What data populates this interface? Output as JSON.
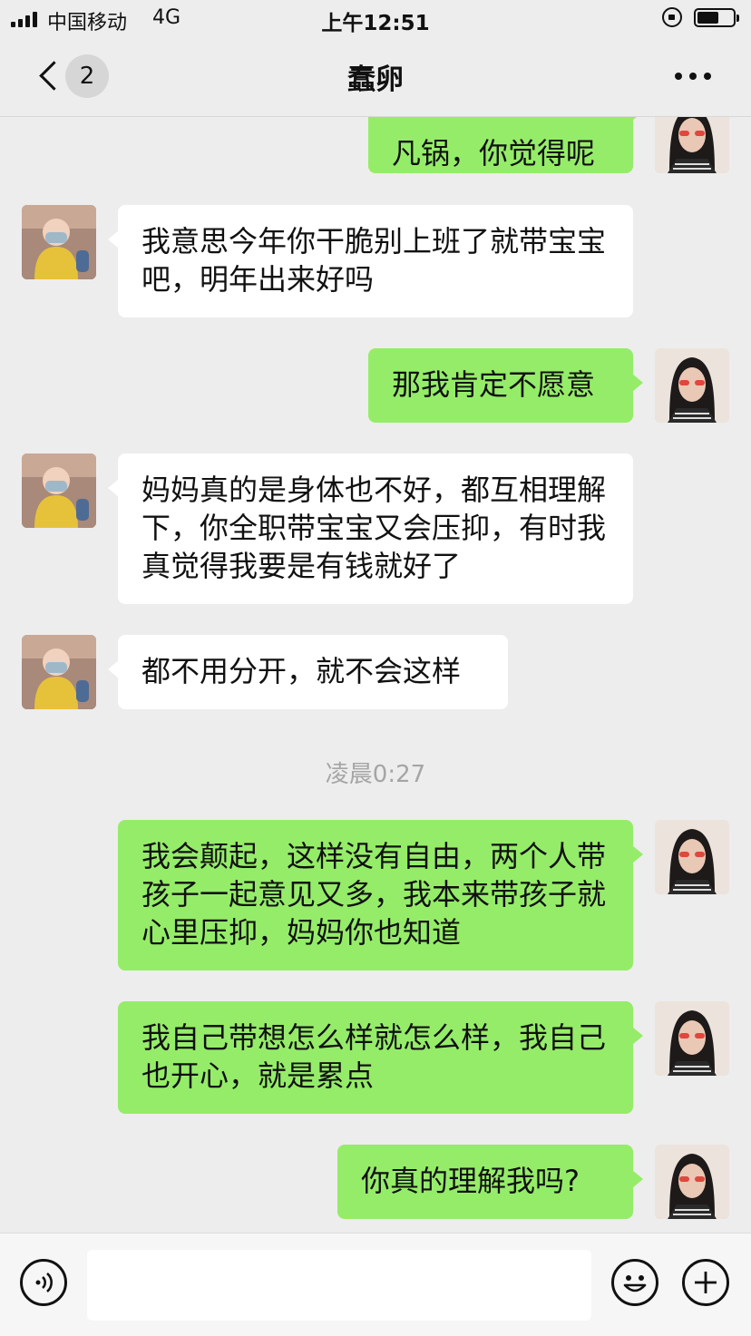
{
  "status_bar": {
    "carrier": "中国移动",
    "network": "4G",
    "time": "上午12:51",
    "battery_level": 0.6
  },
  "nav": {
    "unread_count": "2",
    "title": "蠢卵"
  },
  "messages": [
    {
      "from": "me",
      "text": "凡锅，你觉得呢"
    },
    {
      "from": "other",
      "text": "我意思今年你干脆别上班了就带宝宝吧，明年出来好吗"
    },
    {
      "from": "me",
      "text": "那我肯定不愿意"
    },
    {
      "from": "other",
      "text": "妈妈真的是身体也不好，都互相理解下，你全职带宝宝又会压抑，有时我真觉得我要是有钱就好了"
    },
    {
      "from": "other",
      "text": "都不用分开，就不会这样"
    },
    {
      "from": "me",
      "text": "我会颠起，这样没有自由，两个人带孩子一起意见又多，我本来带孩子就心里压抑，妈妈你也知道"
    },
    {
      "from": "me",
      "text": "我自己带想怎么样就怎么样，我自己也开心，就是累点"
    },
    {
      "from": "me",
      "text": "你真的理解我吗?"
    }
  ],
  "timestamp": "凌晨0:27",
  "input": {
    "value": ""
  },
  "colors": {
    "my_bubble": "#95ec69",
    "other_bubble": "#ffffff",
    "background": "#ededed"
  },
  "icons": {
    "back": "chevron-left-icon",
    "more": "more-dots-icon",
    "voice": "voice-icon",
    "emoji": "emoji-icon",
    "plus": "plus-icon"
  }
}
